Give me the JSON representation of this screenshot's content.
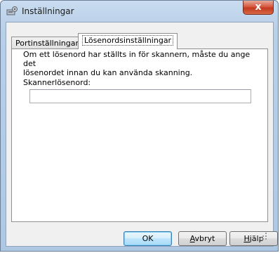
{
  "window": {
    "title": "Inställningar",
    "close_label": "x"
  },
  "tabs": [
    {
      "label": "Portinställningar",
      "selected": false
    },
    {
      "label": "Lösenordsinställningar",
      "selected": true
    }
  ],
  "panel": {
    "info_line1": "Om ett lösenord har ställts in för skannern, måste du ange det",
    "info_line2": "lösenordet innan du kan använda skanning.",
    "password_label": "Skannerlösenord:",
    "password_value": ""
  },
  "buttons": {
    "ok": "OK",
    "cancel_first": "A",
    "cancel_rest": "vbryt",
    "help_first": "H",
    "help_rest": "jälp"
  },
  "colors": {
    "frame": "#b8cfe8",
    "close": "#c94a2e",
    "default_button": "#3c7fb1"
  },
  "icons": {
    "title": "settings-gear-icon",
    "close": "close-icon",
    "resize": "resize-grip-icon"
  }
}
